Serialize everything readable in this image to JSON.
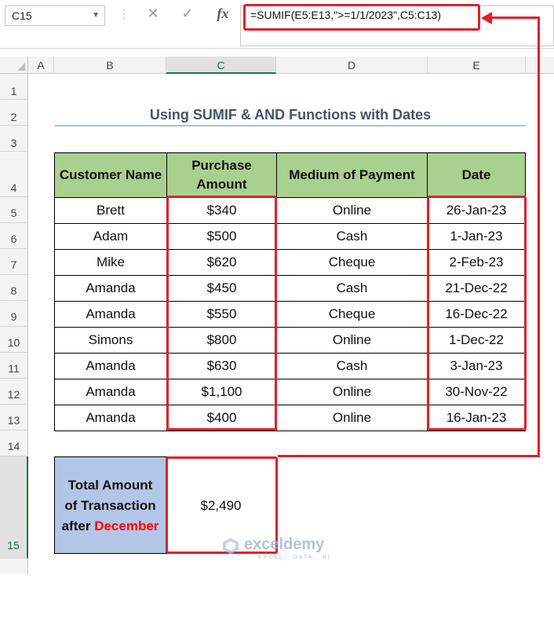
{
  "formula_bar": {
    "name_box": "C15",
    "fx_label": "fx",
    "formula": "=SUMIF(E5:E13,\">=1/1/2023\",C5:C13)"
  },
  "sheet": {
    "column_headers": [
      "A",
      "B",
      "C",
      "D",
      "E"
    ],
    "row_headers": [
      "1",
      "2",
      "3",
      "4",
      "5",
      "6",
      "7",
      "8",
      "9",
      "10",
      "11",
      "12",
      "13",
      "14",
      "15"
    ],
    "title": "Using SUMIF & AND Functions with Dates",
    "table": {
      "headers": [
        "Customer Name",
        "Purchase Amount",
        "Medium of Payment",
        "Date"
      ],
      "rows": [
        [
          "Brett",
          "$340",
          "Online",
          "26-Jan-23"
        ],
        [
          "Adam",
          "$500",
          "Cash",
          "1-Jan-23"
        ],
        [
          "Mike",
          "$620",
          "Cheque",
          "2-Feb-23"
        ],
        [
          "Amanda",
          "$450",
          "Cash",
          "21-Dec-22"
        ],
        [
          "Amanda",
          "$550",
          "Cheque",
          "16-Dec-22"
        ],
        [
          "Simons",
          "$800",
          "Online",
          "1-Dec-22"
        ],
        [
          "Amanda",
          "$630",
          "Cash",
          "3-Jan-23"
        ],
        [
          "Amanda",
          "$1,100",
          "Online",
          "30-Nov-22"
        ],
        [
          "Amanda",
          "$400",
          "Online",
          "16-Jan-23"
        ]
      ]
    },
    "total": {
      "label_line1": "Total Amount",
      "label_line2": "of Transaction",
      "label_line3_prefix": "after",
      "label_line3_highlight": "December",
      "value": "$2,490"
    }
  },
  "watermark": {
    "brand": "exceldemy",
    "tagline": "EXCEL · DATA · BI"
  },
  "colors": {
    "header_fill": "#a9d08e",
    "total_fill": "#b4c6e7",
    "annotation": "#e0202a",
    "title": "#44546a"
  }
}
